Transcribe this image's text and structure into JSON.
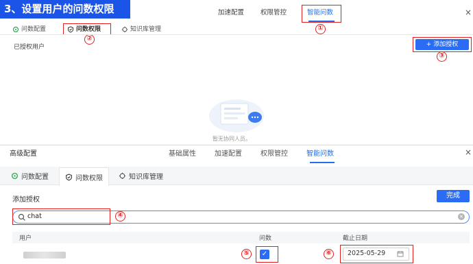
{
  "banner": {
    "title": "3、设置用户的问数权限"
  },
  "top_panel": {
    "tabs": [
      {
        "label": "加速配置"
      },
      {
        "label": "权限管控"
      },
      {
        "label": "智能问数"
      }
    ],
    "close": "×",
    "sub_tabs": [
      {
        "label": "问数配置",
        "icon": "config-icon"
      },
      {
        "label": "问数权限",
        "icon": "shield-icon"
      },
      {
        "label": "知识库管理",
        "icon": "knowledge-icon"
      }
    ],
    "authorized_users_label": "已授权用户",
    "add_button": "+ 添加授权",
    "empty_text": "暂无协同人员。"
  },
  "bottom_panel": {
    "title": "高级配置",
    "tabs": [
      {
        "label": "基础属性"
      },
      {
        "label": "加速配置"
      },
      {
        "label": "权限管控"
      },
      {
        "label": "智能问数"
      }
    ],
    "close": "×",
    "sub_tabs": [
      {
        "label": "问数配置",
        "icon": "config-icon"
      },
      {
        "label": "问数权限",
        "icon": "shield-icon"
      },
      {
        "label": "知识库管理",
        "icon": "knowledge-icon"
      }
    ],
    "add_auth_label": "添加授权",
    "done_button": "完成",
    "search": {
      "value": "chat",
      "clear": "×"
    },
    "table": {
      "headers": [
        "用户",
        "问数",
        "截止日期"
      ],
      "rows": [
        {
          "user": "",
          "checked": true,
          "checkmark": "✓",
          "date": "2025-05-29"
        }
      ]
    }
  },
  "annotations": [
    "①",
    "②",
    "③",
    "④",
    "⑤",
    "⑥"
  ],
  "colors": {
    "accent": "#2a6df4",
    "banner": "#1a55e8",
    "annotation": "#e02020"
  }
}
